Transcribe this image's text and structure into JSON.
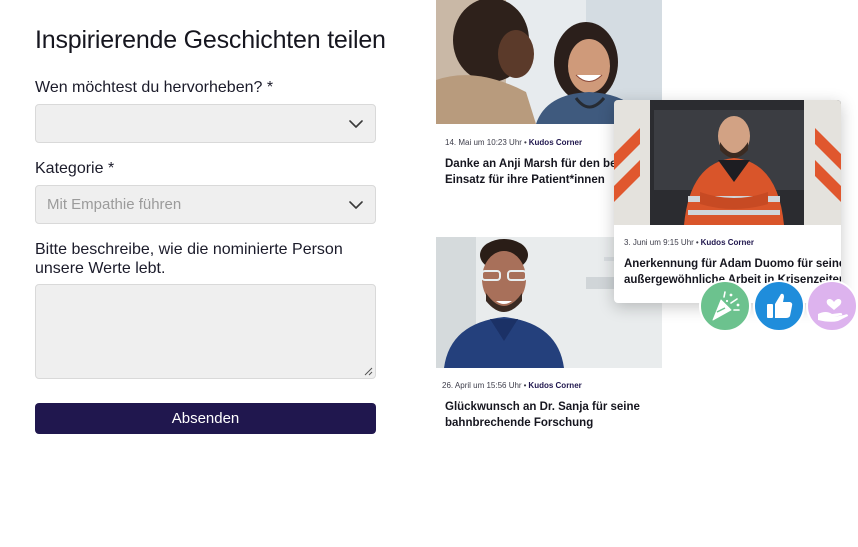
{
  "form": {
    "title": "Inspirierende Geschichten teilen",
    "person_label": "Wen möchtest du hervorheben? *",
    "person_value": "",
    "category_label": "Kategorie *",
    "category_value": "Mit Empathie führen",
    "description_label": "Bitte beschreibe, wie die nominierte Person unsere Werte lebt.",
    "description_value": "",
    "submit_label": "Absenden"
  },
  "cards": [
    {
      "date": "14. Mai um 10:23 Uhr",
      "separator": "•",
      "source": "Kudos Corner",
      "headline_line1": "Danke an Anji Marsh für den besonderen",
      "headline_line2": "Einsatz für ihre Patient*innen"
    },
    {
      "date": "3. Juni um 9:15 Uhr",
      "separator": "•",
      "source": "Kudos Corner",
      "headline_line1": "Anerkennung für Adam Duomo für seine",
      "headline_line2": "außergewöhnliche Arbeit in Krisenzeiten"
    },
    {
      "date": "26. April um 15:56 Uhr",
      "separator": "•",
      "source": "Kudos Corner",
      "headline_line1": "Glückwunsch an Dr. Sanja für seine",
      "headline_line2": "bahnbrechende Forschung"
    }
  ],
  "reactions": [
    {
      "icon": "party-popper-icon",
      "color": "#6cc28e"
    },
    {
      "icon": "thumbs-up-icon",
      "color": "#1f8ddb"
    },
    {
      "icon": "heart-hand-icon",
      "color": "#ddb3ee"
    }
  ],
  "colors": {
    "primary": "#20174e",
    "field_bg": "#efefef",
    "field_border": "#d9d9d9"
  }
}
